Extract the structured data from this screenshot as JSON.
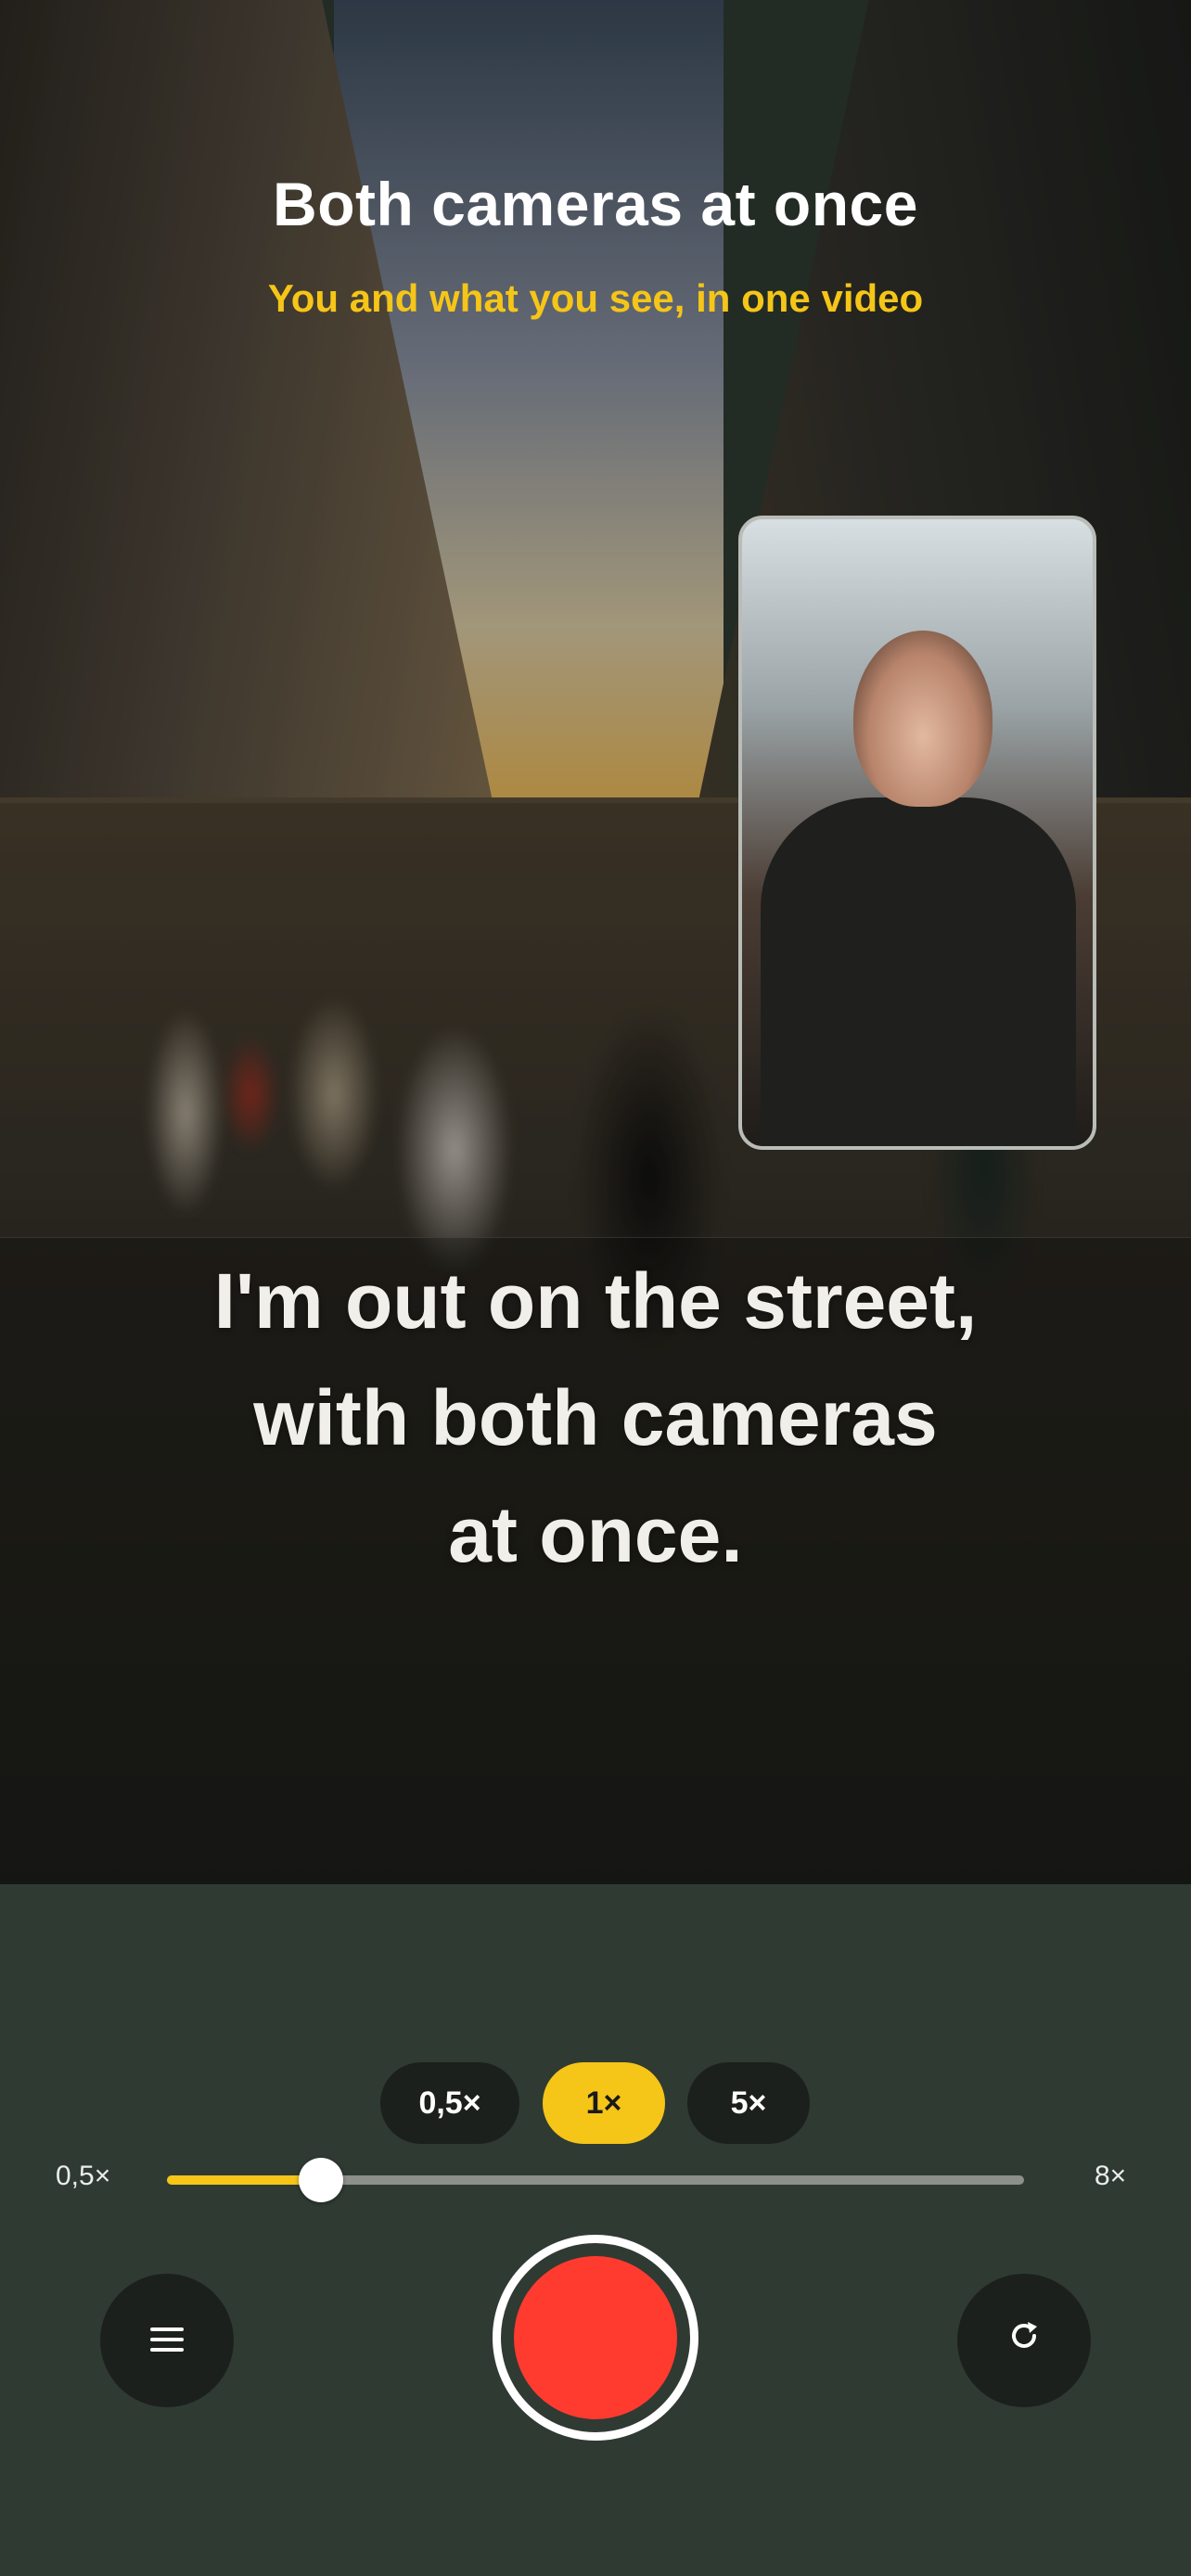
{
  "header": {
    "title": "Both cameras at once",
    "subtitle": "You and what you see, in one video"
  },
  "caption": {
    "line1": "I'm out on the street,",
    "line2": "with both cameras",
    "line3": "at once."
  },
  "zoom": {
    "options": [
      "0,5×",
      "1×",
      "5×"
    ],
    "selected": "1×",
    "min_label": "0,5×",
    "max_label": "8×",
    "level_fraction": 0.18
  },
  "controls": {
    "menu_icon": "menu-icon",
    "flip_icon": "flip-camera-icon",
    "record_icon": "record-button"
  },
  "colors": {
    "accent": "#f5c518",
    "record": "#ff3b30"
  }
}
